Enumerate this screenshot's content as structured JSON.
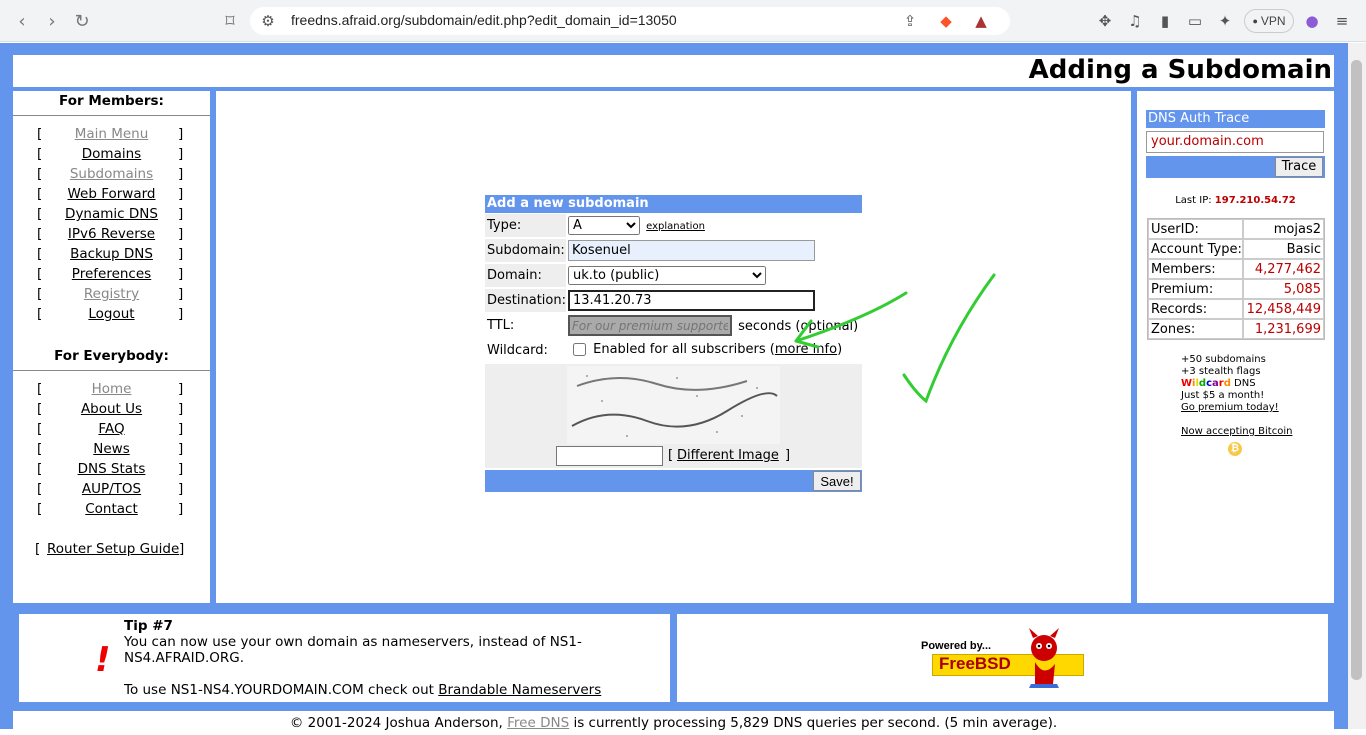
{
  "browser": {
    "url": "freedns.afraid.org/subdomain/edit.php?edit_domain_id=13050",
    "vpn_label": "VPN"
  },
  "page": {
    "title": "Adding a Subdomain"
  },
  "left_nav": {
    "members_header": "For Members:",
    "members_items": [
      {
        "label": "Main Menu",
        "dim": true
      },
      {
        "label": "Domains",
        "dim": false
      },
      {
        "label": "Subdomains",
        "dim": true
      },
      {
        "label": "Web Forward",
        "dim": false
      },
      {
        "label": "Dynamic DNS",
        "dim": false
      },
      {
        "label": "IPv6 Reverse",
        "dim": false
      },
      {
        "label": "Backup DNS",
        "dim": false
      },
      {
        "label": "Preferences",
        "dim": false
      },
      {
        "label": "Registry",
        "dim": true
      },
      {
        "label": "Logout",
        "dim": false
      }
    ],
    "everybody_header": "For Everybody:",
    "everybody_items": [
      {
        "label": "Home",
        "dim": true
      },
      {
        "label": "About Us",
        "dim": false
      },
      {
        "label": "FAQ",
        "dim": false
      },
      {
        "label": "News",
        "dim": false
      },
      {
        "label": "DNS Stats",
        "dim": false
      },
      {
        "label": "AUP/TOS",
        "dim": false
      },
      {
        "label": "Contact",
        "dim": false
      }
    ],
    "router_guide": "Router Setup Guide",
    "bracket_open": "[",
    "bracket_close": "]"
  },
  "form": {
    "header": "Add a new subdomain",
    "type_label": "Type:",
    "type_value": "A",
    "type_explanation": "explanation",
    "subdomain_label": "Subdomain:",
    "subdomain_value": "Kosenuel",
    "domain_label": "Domain:",
    "domain_value": "uk.to (public)",
    "destination_label": "Destination:",
    "destination_value": "13.41.20.73",
    "ttl_label": "TTL:",
    "ttl_placeholder": "For our premium supporter",
    "ttl_suffix": "seconds (optional)",
    "wildcard_label": "Wildcard:",
    "wildcard_text": "Enabled for all subscribers",
    "wildcard_more": "more info",
    "different_image": "Different Image",
    "save_label": "Save!"
  },
  "right_col": {
    "trace_header": "DNS Auth Trace",
    "trace_placeholder": "your.domain.com",
    "trace_button": "Trace",
    "last_ip_label": "Last IP:",
    "last_ip_value": "197.210.54.72",
    "stats": [
      {
        "key": "UserID:",
        "value": "mojas2",
        "black": true
      },
      {
        "key": "Account Type:",
        "value": "Basic",
        "black": true
      },
      {
        "key": "Members:",
        "value": "4,277,462",
        "black": false
      },
      {
        "key": "Premium:",
        "value": "5,085",
        "black": false
      },
      {
        "key": "Records:",
        "value": "12,458,449",
        "black": false
      },
      {
        "key": "Zones:",
        "value": "1,231,699",
        "black": false
      }
    ],
    "promo": {
      "line1": "+50 subdomains",
      "line2": "+3 stealth flags",
      "wildcard_word": "Wildcard",
      "line3_suffix": " DNS",
      "line4": "Just $5 a month!",
      "cta": "Go premium today!",
      "bitcoin": "Now accepting Bitcoin"
    }
  },
  "tip": {
    "title": "Tip #7",
    "text": "You can now use your own domain as nameservers, instead of NS1-NS4.AFRAID.ORG.",
    "text2_prefix": "To use NS1-NS4.YOURDOMAIN.COM check out ",
    "text2_link": "Brandable Nameservers"
  },
  "freebsd": {
    "powered": "Powered by...",
    "name": "FreeBSD"
  },
  "footer": {
    "prefix": "© 2001-2024 Joshua Anderson, ",
    "link": "Free DNS",
    "suffix": " is currently processing 5,829 DNS queries per second. (5 min average)."
  }
}
